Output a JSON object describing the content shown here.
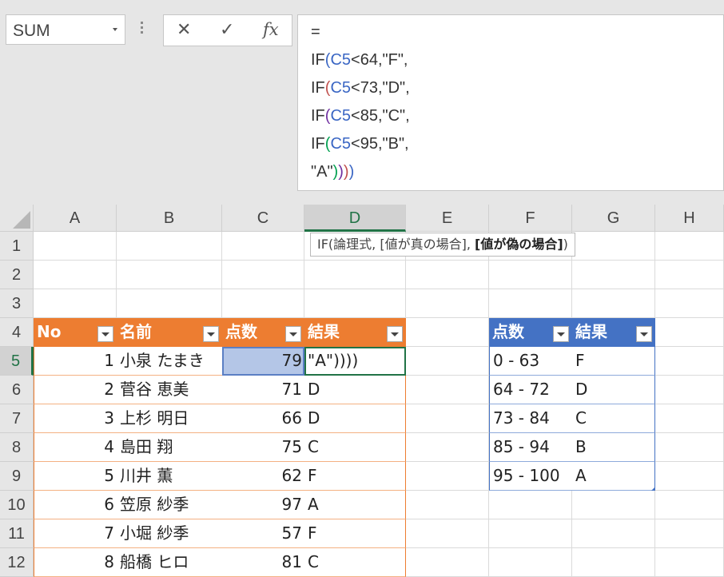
{
  "name_box": {
    "value": "SUM"
  },
  "formula_bar": {
    "cancel_icon": "✕",
    "enter_icon": "✓",
    "fx_label": "fx",
    "lines": [
      [
        {
          "t": "="
        }
      ],
      [
        {
          "t": "IF"
        },
        {
          "t": "(",
          "c": "#3a66c4"
        },
        {
          "t": "C5",
          "c": "#3a66c4"
        },
        {
          "t": "<64,\"F\","
        }
      ],
      [
        {
          "t": "IF"
        },
        {
          "t": "(",
          "c": "#c0504d"
        },
        {
          "t": "C5",
          "c": "#3a66c4"
        },
        {
          "t": "<73,\"D\","
        }
      ],
      [
        {
          "t": "IF"
        },
        {
          "t": "(",
          "c": "#7030a0"
        },
        {
          "t": "C5",
          "c": "#3a66c4"
        },
        {
          "t": "<85,\"C\","
        }
      ],
      [
        {
          "t": "IF"
        },
        {
          "t": "(",
          "c": "#00a050"
        },
        {
          "t": "C5",
          "c": "#3a66c4"
        },
        {
          "t": "<95,\"B\","
        }
      ],
      [
        {
          "t": "\"A\""
        },
        {
          "t": ")",
          "c": "#00a050"
        },
        {
          "t": ")",
          "c": "#7030a0"
        },
        {
          "t": ")",
          "c": "#c0504d"
        },
        {
          "t": ")",
          "c": "#3a66c4"
        }
      ]
    ]
  },
  "columns": [
    "A",
    "B",
    "C",
    "D",
    "E",
    "F",
    "G",
    "H"
  ],
  "rows": [
    "1",
    "2",
    "3",
    "4",
    "5",
    "6",
    "7",
    "8",
    "9",
    "10",
    "11",
    "12"
  ],
  "selected_column": "D",
  "selected_row": "5",
  "tooltip": {
    "prefix": "IF(論理式, [値が真の場合], ",
    "bold": "[値が偽の場合]",
    "suffix": ")"
  },
  "table1": {
    "headers": [
      "No",
      "名前",
      "点数",
      "結果"
    ],
    "rows": [
      [
        "1",
        "小泉 たまき",
        "79",
        "\"A\"))))"
      ],
      [
        "2",
        "菅谷 恵美",
        "71",
        "D"
      ],
      [
        "3",
        "上杉 明日",
        "66",
        "D"
      ],
      [
        "4",
        "島田 翔",
        "75",
        "C"
      ],
      [
        "5",
        "川井 薫",
        "62",
        "F"
      ],
      [
        "6",
        "笠原 紗季",
        "97",
        "A"
      ],
      [
        "7",
        "小堀 紗季",
        "57",
        "F"
      ],
      [
        "8",
        "船橋 ヒロ",
        "81",
        "C"
      ]
    ]
  },
  "table2": {
    "headers": [
      "点数",
      "結果"
    ],
    "rows": [
      [
        "0 - 63",
        "F"
      ],
      [
        "64 - 72",
        "D"
      ],
      [
        "73 - 84",
        "C"
      ],
      [
        "85 - 94",
        "B"
      ],
      [
        "95 - 100",
        "A"
      ]
    ]
  },
  "colors": {
    "accent_green": "#217346",
    "orange_header": "#ed7d31",
    "blue_header": "#4472c4",
    "selection_fill": "#b4c6e7"
  }
}
